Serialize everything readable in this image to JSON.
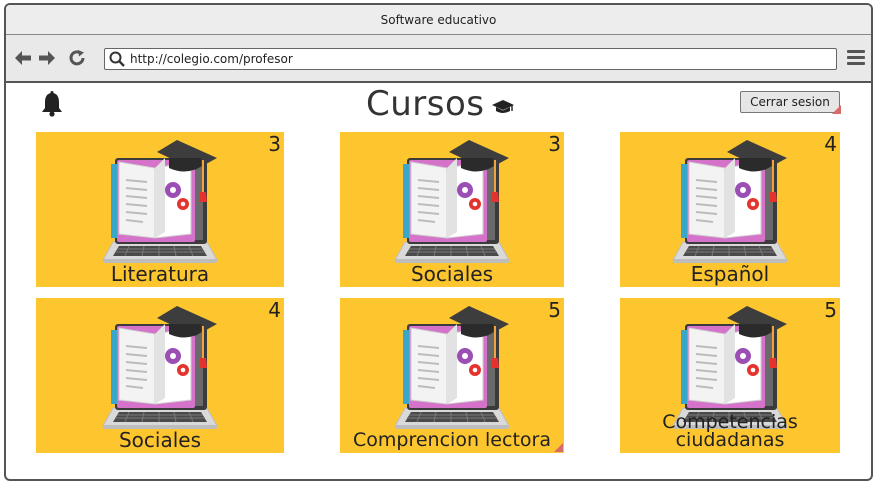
{
  "window": {
    "title": "Software educativo"
  },
  "browser": {
    "url": "http://colegio.com/profesor",
    "back_icon": "arrow-left-icon",
    "forward_icon": "arrow-right-icon",
    "reload_icon": "reload-icon",
    "search_icon": "magnifier-icon",
    "menu_icon": "hamburger-menu-icon"
  },
  "header": {
    "title": "Cursos",
    "title_icon": "graduation-cap-icon",
    "notification_icon": "bell-icon",
    "logout_label": "Cerrar sesion"
  },
  "colors": {
    "card": "#fdc52e",
    "text": "#222222"
  },
  "courses": [
    {
      "name": "Literatura",
      "count": "3",
      "image": "book-laptop-graduation-illustration"
    },
    {
      "name": "Sociales",
      "count": "3",
      "image": "book-laptop-graduation-illustration"
    },
    {
      "name": "Español",
      "count": "4",
      "image": "book-laptop-graduation-illustration"
    },
    {
      "name": "Sociales",
      "count": "4",
      "image": "book-laptop-graduation-illustration"
    },
    {
      "name": "Comprencion lectora",
      "count": "5",
      "image": "book-laptop-graduation-illustration"
    },
    {
      "name": "Competencias ciudadanas",
      "count": "5",
      "image": "book-laptop-graduation-illustration"
    }
  ]
}
